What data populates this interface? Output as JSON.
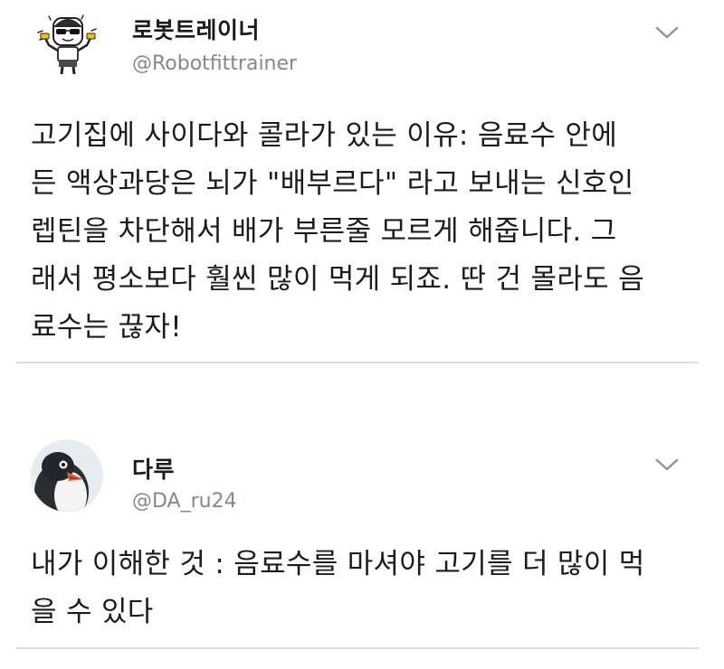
{
  "tweets": [
    {
      "author_name": "로봇트레이너",
      "handle": "@Robotfittrainer",
      "avatar_icon": "cartoon-robot-trainer-avatar",
      "menu_icon": "chevron-down-icon",
      "lines": [
        "고기집에 사이다와 콜라가 있는 이유: 음료수 안에",
        "든 액상과당은 뇌가 \"배부르다\" 라고 보내는 신호인",
        "렙틴을 차단해서 배가 부른줄 모르게 해줍니다. 그",
        "래서 평소보다 훨씬 많이 먹게 되죠. 딴 건 몰라도 음",
        "료수는 끊자!"
      ]
    },
    {
      "author_name": "다루",
      "handle": "@DA_ru24",
      "avatar_icon": "penguin-avatar",
      "menu_icon": "chevron-down-icon",
      "lines": [
        "내가 이해한 것 : 음료수를 마셔야 고기를 더 많이 먹",
        "을 수 있다"
      ]
    }
  ],
  "colors": {
    "text": "#1c1c1c",
    "handle": "#7d8a96",
    "divider": "#d9dee2",
    "chevron": "#8a96a0"
  }
}
